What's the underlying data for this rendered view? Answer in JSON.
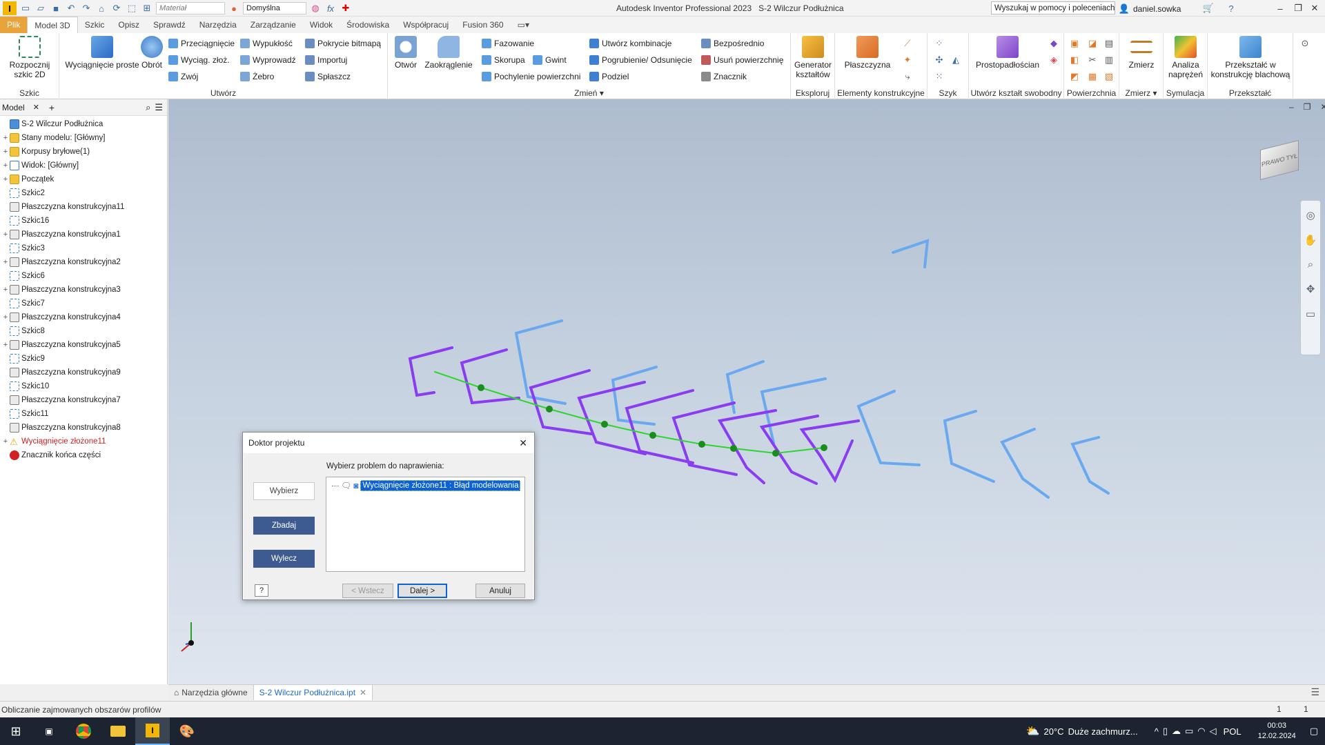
{
  "window": {
    "title": "Autodesk Inventor Professional 2023",
    "document": "S-2 Wilczur Podłużnica",
    "help_search_placeholder": "Wyszukaj w pomocy i poleceniach",
    "user": "daniel.sowka",
    "quick_access": {
      "material": "Materiał",
      "appearance": "Domyślna"
    }
  },
  "tabs": [
    "Plik",
    "Model 3D",
    "Szkic",
    "Opisz",
    "Sprawdź",
    "Narzędzia",
    "Zarządzanie",
    "Widok",
    "Środowiska",
    "Współpracuj",
    "Fusion 360"
  ],
  "ribbon": {
    "szkic": {
      "label": "Szkic",
      "start": "Rozpocznij szkic 2D"
    },
    "utworz": {
      "label": "Utwórz",
      "extrude": "Wyciągnięcie proste",
      "revolve": "Obrót",
      "sweep": "Przeciągnięcie",
      "loft": "Wyciąg. złoż.",
      "coil": "Zwój",
      "emboss": "Wypukłość",
      "derive": "Wyprowadź",
      "rib": "Żebro",
      "decal": "Pokrycie bitmapą",
      "import": "Importuj",
      "unwrap": "Spłaszcz"
    },
    "zmien": {
      "label": "Zmień",
      "hole": "Otwór",
      "fillet": "Zaokrąglenie",
      "chamfer": "Fazowanie",
      "shell": "Skorupa",
      "thread": "Gwint",
      "draft": "Pochylenie powierzchni",
      "combine": "Utwórz kombinacje",
      "thicken": "Pogrubienie/ Odsunięcie",
      "split": "Podziel",
      "direct": "Bezpośrednio",
      "delete_face": "Usuń powierzchnię",
      "marker": "Znacznik"
    },
    "eksploruj": {
      "label": "Eksploruj",
      "generator": "Generator kształtów"
    },
    "elementy": {
      "label": "Elementy konstrukcyjne",
      "plane": "Płaszczyzna"
    },
    "szyk": {
      "label": "Szyk"
    },
    "freeform": {
      "label": "Utwórz kształt swobodny",
      "box": "Prostopadłościan"
    },
    "powierzchnia": {
      "label": "Powierzchnia"
    },
    "zmierz": {
      "label": "Zmierz",
      "measure": "Zmierz"
    },
    "symulacja": {
      "label": "Symulacja",
      "stress": "Analiza naprężeń"
    },
    "przeksztalc": {
      "label": "Przekształć",
      "convert": "Przekształć w konstrukcję blachową"
    }
  },
  "browser": {
    "tab": "Model",
    "nodes": [
      {
        "label": "S-2 Wilczur Podłużnica",
        "expander": "",
        "indent": 0,
        "error": false
      },
      {
        "label": "Stany modelu: [Główny]",
        "expander": "+",
        "indent": 1,
        "error": false
      },
      {
        "label": "Korpusy bryłowe(1)",
        "expander": "+",
        "indent": 1,
        "error": false
      },
      {
        "label": "Widok: [Główny]",
        "expander": "+",
        "indent": 1,
        "error": false
      },
      {
        "label": "Początek",
        "expander": "+",
        "indent": 1,
        "error": false
      },
      {
        "label": "Szkic2",
        "expander": "",
        "indent": 1,
        "error": false
      },
      {
        "label": "Płaszczyzna konstrukcyjna11",
        "expander": "",
        "indent": 1,
        "error": false
      },
      {
        "label": "Szkic16",
        "expander": "",
        "indent": 1,
        "error": false
      },
      {
        "label": "Płaszczyzna konstrukcyjna1",
        "expander": "+",
        "indent": 1,
        "error": false
      },
      {
        "label": "Szkic3",
        "expander": "",
        "indent": 1,
        "error": false
      },
      {
        "label": "Płaszczyzna konstrukcyjna2",
        "expander": "+",
        "indent": 1,
        "error": false
      },
      {
        "label": "Szkic6",
        "expander": "",
        "indent": 1,
        "error": false
      },
      {
        "label": "Płaszczyzna konstrukcyjna3",
        "expander": "+",
        "indent": 1,
        "error": false
      },
      {
        "label": "Szkic7",
        "expander": "",
        "indent": 1,
        "error": false
      },
      {
        "label": "Płaszczyzna konstrukcyjna4",
        "expander": "+",
        "indent": 1,
        "error": false
      },
      {
        "label": "Szkic8",
        "expander": "",
        "indent": 1,
        "error": false
      },
      {
        "label": "Płaszczyzna konstrukcyjna5",
        "expander": "+",
        "indent": 1,
        "error": false
      },
      {
        "label": "Szkic9",
        "expander": "",
        "indent": 1,
        "error": false
      },
      {
        "label": "Płaszczyzna konstrukcyjna9",
        "expander": "",
        "indent": 1,
        "error": false
      },
      {
        "label": "Szkic10",
        "expander": "",
        "indent": 1,
        "error": false
      },
      {
        "label": "Płaszczyzna konstrukcyjna7",
        "expander": "",
        "indent": 1,
        "error": false
      },
      {
        "label": "Szkic11",
        "expander": "",
        "indent": 1,
        "error": false
      },
      {
        "label": "Płaszczyzna konstrukcyjna8",
        "expander": "",
        "indent": 1,
        "error": false
      },
      {
        "label": "Wyciągnięcie złożone11",
        "expander": "+",
        "indent": 1,
        "error": true
      },
      {
        "label": "Znacznik końca części",
        "expander": "",
        "indent": 1,
        "error": false
      }
    ]
  },
  "viewcube": {
    "face1": "PRAWO",
    "face2": "TYŁ"
  },
  "dialog": {
    "title": "Doktor projektu",
    "prompt": "Wybierz problem do naprawienia:",
    "steps": [
      "Wybierz",
      "Zbadaj",
      "Wylecz"
    ],
    "problem": "Wyciągnięcie złożone11 : Błąd modelowania",
    "back": "< Wstecz",
    "next": "Dalej >",
    "cancel": "Anuluj"
  },
  "doc_tabs": {
    "home": "Narzędzia główne",
    "active": "S-2 Wilczur Podłużnica.ipt"
  },
  "status": {
    "message": "Obliczanie zajmowanych obszarów profilów",
    "count1": "1",
    "count2": "1"
  },
  "taskbar": {
    "temp": "20°C",
    "weather": "Duże zachmurz...",
    "lang": "POL",
    "time": "00:03",
    "date": "12.02.2024"
  },
  "colors": {
    "accent": "#1b6ac9",
    "file_tab": "#e8a33b",
    "profile": "#8a3cf0",
    "rail": "#2fd52f",
    "sketch": "#6aa8ef",
    "error": "#d32020",
    "dialog_step": "#3d5a91"
  }
}
